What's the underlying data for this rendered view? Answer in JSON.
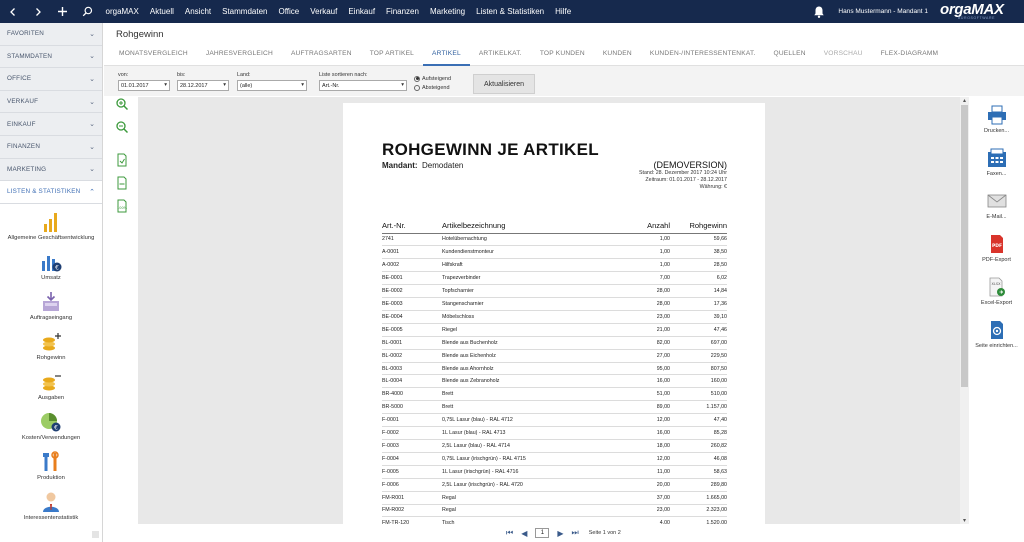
{
  "topbar": {
    "menu": [
      "orgaMAX",
      "Aktuell",
      "Ansicht",
      "Stammdaten",
      "Office",
      "Verkauf",
      "Einkauf",
      "Finanzen",
      "Marketing",
      "Listen & Statistiken",
      "Hilfe"
    ],
    "user": "Hans Mustermann - Mandant 1",
    "logo": "orgaMAX",
    "logo_sub": "BÜROSOFTWARE"
  },
  "sidebar": {
    "sections": [
      {
        "label": "FAVORITEN"
      },
      {
        "label": "STAMMDATEN"
      },
      {
        "label": "OFFICE"
      },
      {
        "label": "VERKAUF"
      },
      {
        "label": "EINKAUF"
      },
      {
        "label": "FINANZEN"
      },
      {
        "label": "MARKETING"
      },
      {
        "label": "LISTEN & STATISTIKEN"
      }
    ],
    "items": [
      {
        "label": "Allgemeine Geschäftsentwicklung"
      },
      {
        "label": "Umsatz"
      },
      {
        "label": "Auftragseingang"
      },
      {
        "label": "Rohgewinn"
      },
      {
        "label": "Ausgaben"
      },
      {
        "label": "Kosten/Verwendungen"
      },
      {
        "label": "Produktion"
      },
      {
        "label": "Interessentenstatistik"
      }
    ]
  },
  "page": {
    "title": "Rohgewinn"
  },
  "tabs": [
    {
      "label": "MONATSVERGLEICH"
    },
    {
      "label": "JAHRESVERGLEICH"
    },
    {
      "label": "AUFTRAGSARTEN"
    },
    {
      "label": "TOP ARTIKEL"
    },
    {
      "label": "ARTIKEL"
    },
    {
      "label": "ARTIKELKAT."
    },
    {
      "label": "TOP KUNDEN"
    },
    {
      "label": "KUNDEN"
    },
    {
      "label": "KUNDEN-/INTERESSENTENKAT."
    },
    {
      "label": "QUELLEN"
    },
    {
      "label": "VORSCHAU"
    },
    {
      "label": "FLEX-DIAGRAMM"
    }
  ],
  "filters": {
    "von_label": "von:",
    "von_value": "01.01.2017",
    "bis_label": "bis:",
    "bis_value": "28.12.2017",
    "land_label": "Land:",
    "land_value": "(alle)",
    "sort_label": "Liste sortieren nach:",
    "sort_value": "Art.-Nr.",
    "asc": "Aufsteigend",
    "desc": "Absteigend",
    "update": "Aktualisieren"
  },
  "report": {
    "title": "ROHGEWINN JE ARTIKEL",
    "mandant_label": "Mandant:",
    "mandant_value": "Demodaten",
    "demo": "(DEMOVERSION)",
    "stand": "Stand:  28. Dezember 2017 10:24 Uhr",
    "zeitraum": "Zeitraum: 01.01.2017 - 28.12.2017",
    "waehrung": "Währung: €",
    "headers": {
      "nr": "Art.-Nr.",
      "bez": "Artikelbezeichnung",
      "anzahl": "Anzahl",
      "rohgewinn": "Rohgewinn"
    },
    "rows": [
      [
        "2741",
        "Hotelübernachtung",
        "1,00",
        "59,66"
      ],
      [
        "A-0001",
        "Kundendienstmonteur",
        "1,00",
        "38,50"
      ],
      [
        "A-0002",
        "Hilfskraft",
        "1,00",
        "28,50"
      ],
      [
        "BE-0001",
        "Trapezverbinder",
        "7,00",
        "6,02"
      ],
      [
        "BE-0002",
        "Topfscharnier",
        "28,00",
        "14,84"
      ],
      [
        "BE-0003",
        "Stangenscharnier",
        "28,00",
        "17,36"
      ],
      [
        "BE-0004",
        "Möbelschloss",
        "23,00",
        "39,10"
      ],
      [
        "BE-0005",
        "Riegel",
        "21,00",
        "47,46"
      ],
      [
        "BL-0001",
        "Blende aus Buchenholz",
        "82,00",
        "697,00"
      ],
      [
        "BL-0002",
        "Blende aus Eichenholz",
        "27,00",
        "229,50"
      ],
      [
        "BL-0003",
        "Blende aus Ahornholz",
        "95,00",
        "807,50"
      ],
      [
        "BL-0004",
        "Blende aus Zebranoholz",
        "16,00",
        "160,00"
      ],
      [
        "BR-4000",
        "Brett",
        "51,00",
        "510,00"
      ],
      [
        "BR-5000",
        "Brett",
        "89,00",
        "1.157,00"
      ],
      [
        "F-0001",
        "0,75L Lasur (blau) - RAL 4712",
        "12,00",
        "47,40"
      ],
      [
        "F-0002",
        "1L Lasur (blau) - RAL 4713",
        "16,00",
        "85,28"
      ],
      [
        "F-0003",
        "2,5L Lasur (blau) - RAL 4714",
        "18,00",
        "260,82"
      ],
      [
        "F-0004",
        "0,75L Lasur (irischgrün) - RAL 4715",
        "12,00",
        "46,08"
      ],
      [
        "F-0005",
        "1L Lasur (irischgrün) - RAL 4716",
        "11,00",
        "58,63"
      ],
      [
        "F-0006",
        "2,5L Lasur (irischgrün) - RAL 4720",
        "20,00",
        "289,80"
      ],
      [
        "FM-R001",
        "Regal",
        "37,00",
        "1.665,00"
      ],
      [
        "FM-R002",
        "Regal",
        "23,00",
        "2.323,00"
      ],
      [
        "FM-TR-120",
        "Tisch",
        "4,00",
        "1.520,00"
      ]
    ]
  },
  "right_tools": [
    {
      "label": "Drucken...",
      "icon": "printer-icon"
    },
    {
      "label": "Faxen...",
      "icon": "fax-icon"
    },
    {
      "label": "E-Mail...",
      "icon": "email-icon"
    },
    {
      "label": "PDF-Export",
      "icon": "pdf-icon"
    },
    {
      "label": "Excel-Export",
      "icon": "excel-icon"
    },
    {
      "label": "Seite einrichten...",
      "icon": "page-setup-icon"
    }
  ],
  "pager": {
    "current": "1",
    "info": "Seite 1 von 2"
  },
  "colors": {
    "topbar": "#16294d",
    "accent": "#3a6fb5"
  }
}
